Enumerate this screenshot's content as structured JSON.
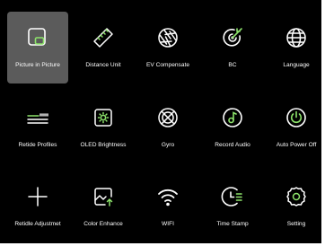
{
  "colors": {
    "background": "#000000",
    "selected_tile": "#5b5b5b",
    "accent": "#8de36b",
    "text": "#ffffff"
  },
  "menu": {
    "items": [
      {
        "label": "Picture in Picture",
        "icon": "picture-in-picture-icon",
        "selected": true
      },
      {
        "label": "Distance Unit",
        "icon": "ruler-icon",
        "selected": false
      },
      {
        "label": "EV Compensate",
        "icon": "aperture-icon",
        "selected": false
      },
      {
        "label": "BC",
        "icon": "target-icon",
        "selected": false
      },
      {
        "label": "Language",
        "icon": "globe-icon",
        "selected": false
      },
      {
        "label": "Retide Profiles",
        "icon": "reticle-profile-icon",
        "selected": false
      },
      {
        "label": "OLED Brightness",
        "icon": "brightness-icon",
        "selected": false
      },
      {
        "label": "Gyro",
        "icon": "gyro-icon",
        "selected": false
      },
      {
        "label": "Record Audio",
        "icon": "record-audio-icon",
        "selected": false
      },
      {
        "label": "Auto Power Off",
        "icon": "power-off-icon",
        "selected": false
      },
      {
        "label": "Retidle Adjustmet",
        "icon": "crosshair-plus-icon",
        "selected": false
      },
      {
        "label": "Color Enhance",
        "icon": "image-enhance-icon",
        "selected": false
      },
      {
        "label": "WIFI",
        "icon": "wifi-icon",
        "selected": false
      },
      {
        "label": "Time Stamp",
        "icon": "time-stamp-icon",
        "selected": false
      },
      {
        "label": "Setting",
        "icon": "gear-icon",
        "selected": false
      }
    ]
  }
}
